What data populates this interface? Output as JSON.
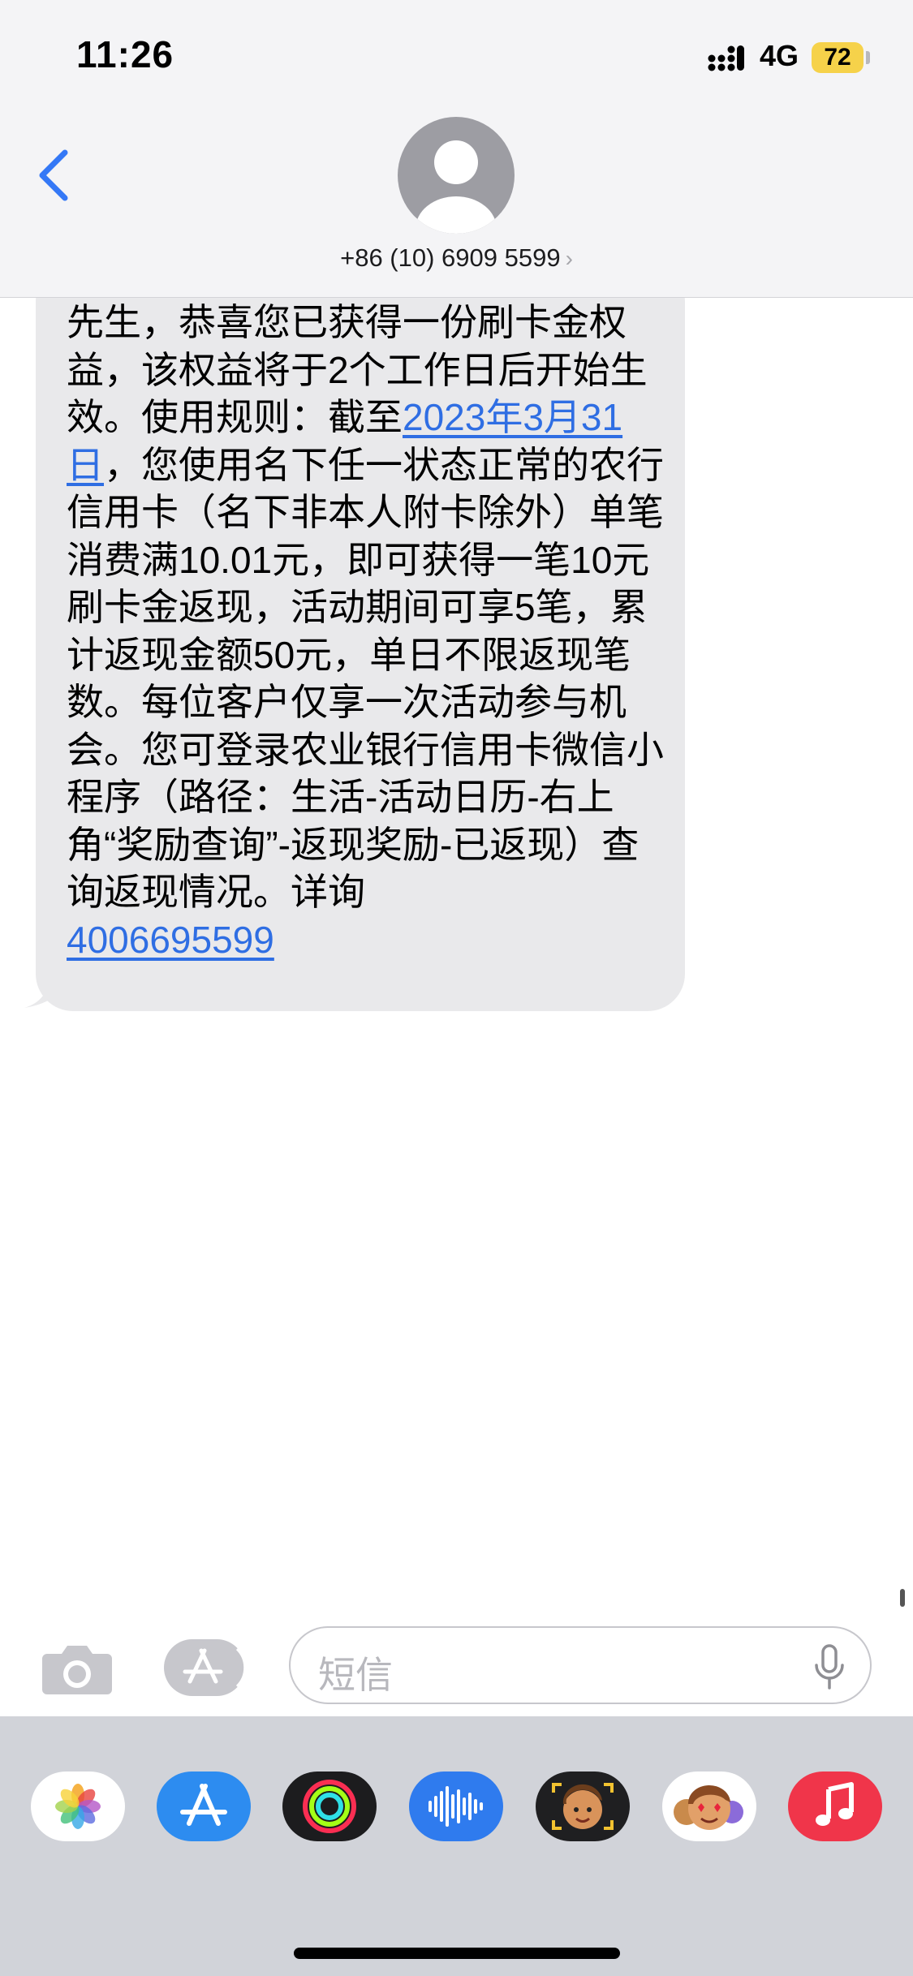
{
  "status_bar": {
    "time": "11:26",
    "network": "4G",
    "battery": "72"
  },
  "header": {
    "contact": "+86 (10) 6909 5599",
    "chevron": "›"
  },
  "message": {
    "parts": [
      {
        "text": "先生，恭喜您已获得一份刷卡金权益，该权益将于2个工作日后开始生效。使用规则：截至",
        "link": false
      },
      {
        "text": "2023年3月31日",
        "link": true
      },
      {
        "text": "，您使用名下任一状态正常的农行信用卡（名下非本人附卡除外）单笔消费满10.01元，即可获得一笔10元刷卡金返现，活动期间可享5笔，累计返现金额50元，单日不限返现笔数。每位客户仅享一次活动参与机会。您可登录农业银行信用卡微信小程序（路径：生活-活动日历-右上角“奖励查询”-返现奖励-已返现）查询返现情况。详询",
        "link": false
      },
      {
        "text": "4006695599",
        "link": true
      }
    ]
  },
  "input": {
    "placeholder": "短信"
  },
  "colors": {
    "link": "#2f6ee3",
    "bubble": "#e9e9eb",
    "accent": "#3478f6",
    "battery": "#f6d24a"
  },
  "icons": {
    "back": "chevron-left-icon",
    "camera": "camera-icon",
    "apps": "app-store-icon",
    "mic": "microphone-icon",
    "drawer": [
      "photos-icon",
      "app-store-icon",
      "activity-icon",
      "audio-message-icon",
      "memoji-icon",
      "memoji-stickers-icon",
      "music-icon"
    ]
  }
}
